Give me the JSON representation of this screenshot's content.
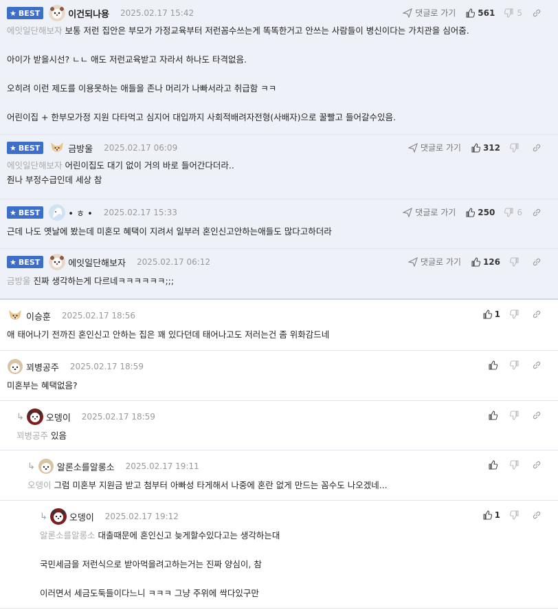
{
  "ui": {
    "best_label": "BEST",
    "reply_go_label": "댓글로 가기"
  },
  "comments": [
    {
      "nick": "이건되나용",
      "date": "2025.02.17 15:42",
      "up": "561",
      "down": "5",
      "to": "에잇일단해보자",
      "lines": "보통 저런 집안은 부모가 가정교육부터 저런꼼수쓰는게 똑똑한거고 안쓰는 사람들이 병신이다는 가치관을 심어줌.\n\n아이가 받을시선? ㄴㄴ 애도 저런교육받고 자라서 하나도 타격없음.\n\n오히려 이런 제도를 이용못하는 애들을 존나 머리가 나빠서라고 취급함 ㅋㅋ\n\n어린이집 + 한부모가정 지원 다타먹고 심지어 대입까지 사회적배려자전형(사배자)으로 꿀빨고 들어갈수있음."
    },
    {
      "nick": "금방울",
      "date": "2025.02.17 06:09",
      "up": "312",
      "down": "",
      "to": "에잇일단해보자",
      "lines": "어린이집도 대기 없이 거의 바로 들어간다더라..\n줜나 부정수급인데 세상 참"
    },
    {
      "nick": "•  ㅎ  •",
      "date": "2025.02.17 15:33",
      "up": "250",
      "down": "6",
      "to": "",
      "lines": "근데 나도 옛날에 봤는데 미혼모 혜택이 지려서 일부러 혼인신고안하는애들도 많다고하더라"
    },
    {
      "nick": "에잇일단해보자",
      "date": "2025.02.17 06:12",
      "up": "126",
      "down": "",
      "to": "금방울",
      "lines": "진짜 생각하는게 다르네ㅋㅋㅋㅋㅋㅋ;;;"
    },
    {
      "nick": "이승훈",
      "date": "2025.02.17 18:56",
      "up": "1",
      "down": "",
      "to": "",
      "lines": "애 태어나기 전까진 혼인신고 안하는 집은 꽤 있다던데 태어나고도 저러는건 좀 위화감드네"
    },
    {
      "nick": "꾀병공주",
      "date": "2025.02.17 18:59",
      "up": "",
      "down": "",
      "to": "",
      "lines": "미혼부는 혜택없음?"
    },
    {
      "nick": "오뎅이",
      "date": "2025.02.17 18:59",
      "up": "",
      "down": "",
      "to": "꾀병공주",
      "lines": "있음"
    },
    {
      "nick": "알론소를알롱소",
      "date": "2025.02.17 19:11",
      "up": "",
      "down": "",
      "to": "오뎅이",
      "lines": "그럼 미혼부 지원금 받고 첨부터 아빠성 타게해서 나중에 혼란 없게 만드는 꼼수도 나오겠네..."
    },
    {
      "nick": "오뎅이",
      "date": "2025.02.17 19:12",
      "up": "1",
      "down": "",
      "to": "알론소를알롱소",
      "lines": "대출때문에 혼인신고 늦게할수있다고는 생각하는대\n\n국민세금을 저런식으로 받아먹을려고하는거는 진짜 양심이, 참\n\n이러면서 세금도둑들이다느니 ㅋㅋㅋ 그냥 주위에 싹다있구만"
    }
  ]
}
